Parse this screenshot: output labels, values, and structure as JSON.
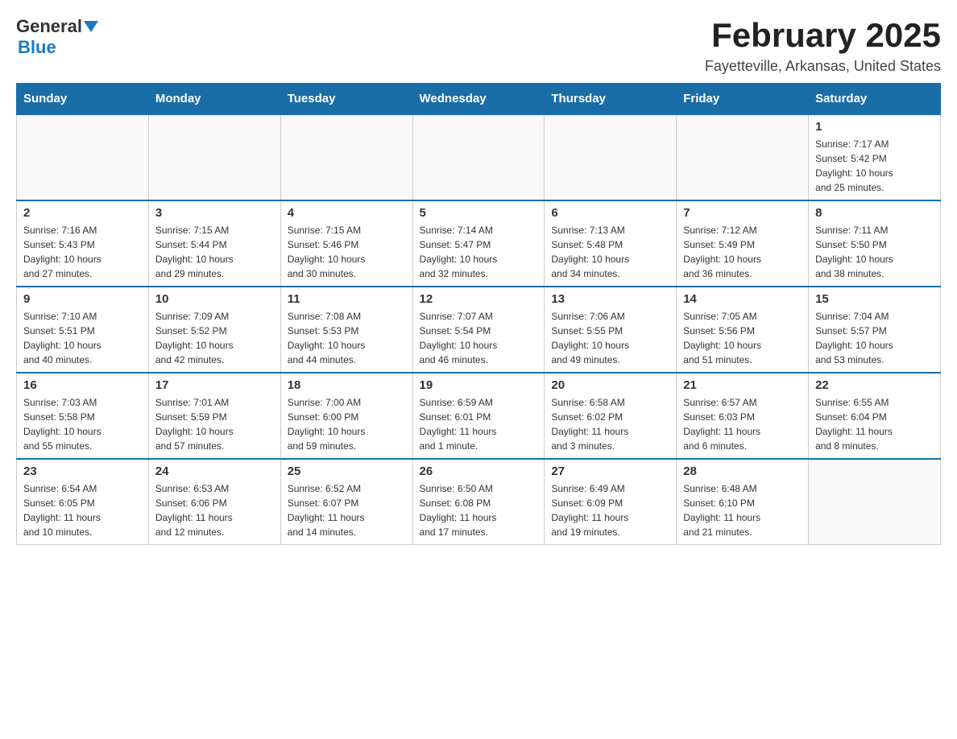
{
  "header": {
    "logo_general": "General",
    "logo_blue": "Blue",
    "title": "February 2025",
    "subtitle": "Fayetteville, Arkansas, United States"
  },
  "weekdays": [
    "Sunday",
    "Monday",
    "Tuesday",
    "Wednesday",
    "Thursday",
    "Friday",
    "Saturday"
  ],
  "weeks": [
    [
      {
        "day": "",
        "info": ""
      },
      {
        "day": "",
        "info": ""
      },
      {
        "day": "",
        "info": ""
      },
      {
        "day": "",
        "info": ""
      },
      {
        "day": "",
        "info": ""
      },
      {
        "day": "",
        "info": ""
      },
      {
        "day": "1",
        "info": "Sunrise: 7:17 AM\nSunset: 5:42 PM\nDaylight: 10 hours\nand 25 minutes."
      }
    ],
    [
      {
        "day": "2",
        "info": "Sunrise: 7:16 AM\nSunset: 5:43 PM\nDaylight: 10 hours\nand 27 minutes."
      },
      {
        "day": "3",
        "info": "Sunrise: 7:15 AM\nSunset: 5:44 PM\nDaylight: 10 hours\nand 29 minutes."
      },
      {
        "day": "4",
        "info": "Sunrise: 7:15 AM\nSunset: 5:46 PM\nDaylight: 10 hours\nand 30 minutes."
      },
      {
        "day": "5",
        "info": "Sunrise: 7:14 AM\nSunset: 5:47 PM\nDaylight: 10 hours\nand 32 minutes."
      },
      {
        "day": "6",
        "info": "Sunrise: 7:13 AM\nSunset: 5:48 PM\nDaylight: 10 hours\nand 34 minutes."
      },
      {
        "day": "7",
        "info": "Sunrise: 7:12 AM\nSunset: 5:49 PM\nDaylight: 10 hours\nand 36 minutes."
      },
      {
        "day": "8",
        "info": "Sunrise: 7:11 AM\nSunset: 5:50 PM\nDaylight: 10 hours\nand 38 minutes."
      }
    ],
    [
      {
        "day": "9",
        "info": "Sunrise: 7:10 AM\nSunset: 5:51 PM\nDaylight: 10 hours\nand 40 minutes."
      },
      {
        "day": "10",
        "info": "Sunrise: 7:09 AM\nSunset: 5:52 PM\nDaylight: 10 hours\nand 42 minutes."
      },
      {
        "day": "11",
        "info": "Sunrise: 7:08 AM\nSunset: 5:53 PM\nDaylight: 10 hours\nand 44 minutes."
      },
      {
        "day": "12",
        "info": "Sunrise: 7:07 AM\nSunset: 5:54 PM\nDaylight: 10 hours\nand 46 minutes."
      },
      {
        "day": "13",
        "info": "Sunrise: 7:06 AM\nSunset: 5:55 PM\nDaylight: 10 hours\nand 49 minutes."
      },
      {
        "day": "14",
        "info": "Sunrise: 7:05 AM\nSunset: 5:56 PM\nDaylight: 10 hours\nand 51 minutes."
      },
      {
        "day": "15",
        "info": "Sunrise: 7:04 AM\nSunset: 5:57 PM\nDaylight: 10 hours\nand 53 minutes."
      }
    ],
    [
      {
        "day": "16",
        "info": "Sunrise: 7:03 AM\nSunset: 5:58 PM\nDaylight: 10 hours\nand 55 minutes."
      },
      {
        "day": "17",
        "info": "Sunrise: 7:01 AM\nSunset: 5:59 PM\nDaylight: 10 hours\nand 57 minutes."
      },
      {
        "day": "18",
        "info": "Sunrise: 7:00 AM\nSunset: 6:00 PM\nDaylight: 10 hours\nand 59 minutes."
      },
      {
        "day": "19",
        "info": "Sunrise: 6:59 AM\nSunset: 6:01 PM\nDaylight: 11 hours\nand 1 minute."
      },
      {
        "day": "20",
        "info": "Sunrise: 6:58 AM\nSunset: 6:02 PM\nDaylight: 11 hours\nand 3 minutes."
      },
      {
        "day": "21",
        "info": "Sunrise: 6:57 AM\nSunset: 6:03 PM\nDaylight: 11 hours\nand 6 minutes."
      },
      {
        "day": "22",
        "info": "Sunrise: 6:55 AM\nSunset: 6:04 PM\nDaylight: 11 hours\nand 8 minutes."
      }
    ],
    [
      {
        "day": "23",
        "info": "Sunrise: 6:54 AM\nSunset: 6:05 PM\nDaylight: 11 hours\nand 10 minutes."
      },
      {
        "day": "24",
        "info": "Sunrise: 6:53 AM\nSunset: 6:06 PM\nDaylight: 11 hours\nand 12 minutes."
      },
      {
        "day": "25",
        "info": "Sunrise: 6:52 AM\nSunset: 6:07 PM\nDaylight: 11 hours\nand 14 minutes."
      },
      {
        "day": "26",
        "info": "Sunrise: 6:50 AM\nSunset: 6:08 PM\nDaylight: 11 hours\nand 17 minutes."
      },
      {
        "day": "27",
        "info": "Sunrise: 6:49 AM\nSunset: 6:09 PM\nDaylight: 11 hours\nand 19 minutes."
      },
      {
        "day": "28",
        "info": "Sunrise: 6:48 AM\nSunset: 6:10 PM\nDaylight: 11 hours\nand 21 minutes."
      },
      {
        "day": "",
        "info": ""
      }
    ]
  ]
}
